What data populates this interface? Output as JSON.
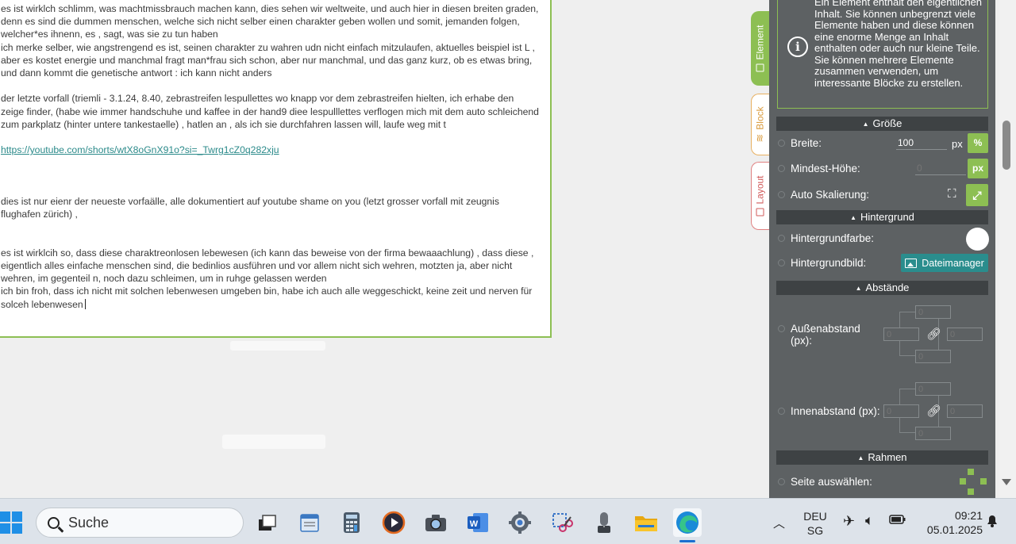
{
  "editor": {
    "paragraphs": [
      "es ist wirklch schlimm, was machtmissbrauch machen kann, dies sehen wir weltweite, und auch hier in diesen breiten graden,",
      "denn es sind die dummen menschen, welche sich nicht selber einen charakter geben wollen und somit, jemanden folgen,",
      "welcher*es ihnenn, es , sagt, was sie zu tun haben",
      "ich merke selber, wie angstrengend es ist, seinen charakter zu wahren udn nicht einfach mitzulaufen, aktuelles beispiel ist L ,",
      "aber es kostet energie und manchmal fragt man*frau sich schon, aber nur manchmal, und das ganz kurz, ob es etwas bring,",
      "und dann kommt die genetische antwort : ich kann nicht anders",
      "der letzte vorfall (triemli - 3.1.24, 8.40, zebrastreifen lespullettes wo knapp vor dem zebrastreifen hielten, ich erhabe den",
      "zeige finder, (habe wie immer handschuhe und kaffee in der hand9 diee lespulllettes verflogen mich mit dem auto schleichend",
      "zum parkplatz (hinter untere tankestaelle) , hatlen an , als ich sie durchfahren lassen will, laufe weg mit t",
      "https://youtube.com/shorts/wtX8oGnX91o?si=_Twrg1cZ0q282xju",
      "dies ist nur eienr der neueste vorfaälle, alle dokumentiert auf youtube shame on you  (letzt grosser vorfall mit zeugnis",
      "flughafen zürich) ,",
      "es ist wirklcih so, dass diese charaktreonlosen lebewesen (ich kann das beweise von der firma bewaaachlung) , dass diese ,",
      "eigentlich alles einfache menschen sind, die bedinlios ausführen und vor allem nicht sich wehren, motzten ja, aber nicht",
      "wehren, im gegenteil n, noch dazu schleimen, um in ruhge gelassen werden",
      "ich bin froh, dass ich nicht mit solchen lebenwesen umgeben bin, habe ich auch alle weggeschickt, keine zeit und nerven für",
      "solceh lebenwesen"
    ]
  },
  "tabs": {
    "element": "Element",
    "block": "Block",
    "layout": "Layout"
  },
  "panel": {
    "info_text": "Ein Element enthält den eigentlichen Inhalt. Sie können unbegrenzt viele Elemente haben und diese können eine enorme Menge an Inhalt enthalten oder auch nur kleine Teile. Sie können mehrere Elemente zusammen verwenden, um interessante Blöcke zu erstellen.",
    "sections": {
      "size": "Größe",
      "background": "Hintergrund",
      "spacing": "Abstände",
      "border": "Rahmen"
    },
    "width": {
      "label": "Breite:",
      "value": "100",
      "unit_px": "px",
      "unit_pct": "%"
    },
    "min_height": {
      "label": "Mindest-Höhe:",
      "placeholder": "0",
      "unit": "px"
    },
    "auto_scale": {
      "label": "Auto Skalierung:"
    },
    "bg_color": {
      "label": "Hintergrundfarbe:",
      "value": "#ffffff"
    },
    "bg_image": {
      "label": "Hintergrundbild:",
      "button": "Dateimanager"
    },
    "margin": {
      "label_line1": "Außenabstand",
      "label_line2": "(px):",
      "top": "0",
      "left": "0",
      "right": "0",
      "bottom": "0"
    },
    "padding": {
      "label": "Innenabstand (px):",
      "top": "0",
      "left": "0",
      "right": "0",
      "bottom": "0"
    },
    "border_side": {
      "label": "Seite auswählen:"
    }
  },
  "taskbar": {
    "search_label": "Suche",
    "language": "DEU",
    "region": "SG",
    "time": "09:21",
    "date": "05.01.2025",
    "apps": [
      "task-view",
      "notepad",
      "calculator",
      "media-player",
      "camera",
      "word",
      "settings",
      "snipping-tool",
      "voice-recorder",
      "file-explorer",
      "edge"
    ]
  },
  "colors": {
    "accent_green": "#8dbf53",
    "panel_bg": "#5d6163",
    "section_header": "#3e4244",
    "teal_button": "#2a8d8d",
    "link": "#2b8a8a"
  }
}
